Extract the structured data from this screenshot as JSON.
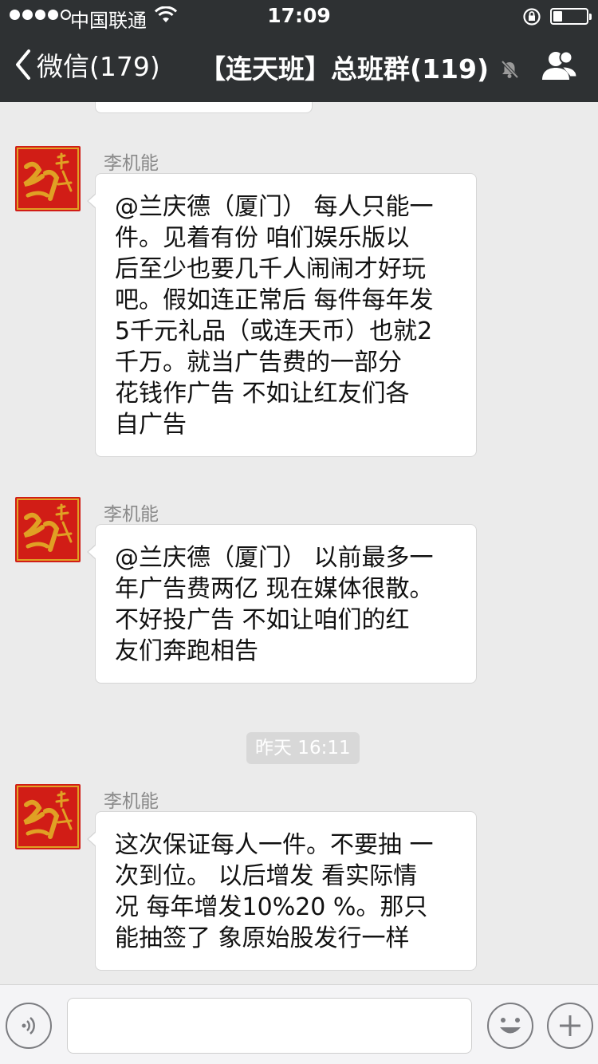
{
  "status_bar": {
    "carrier": "中国联通",
    "time": "17:09",
    "signal_bars": 4,
    "battery_level": 0.28
  },
  "nav": {
    "back_label": "微信(179)",
    "title": "【连天班】总班群(119)"
  },
  "messages": [
    {
      "sender": "李机能",
      "lines": [
        "@兰庆德（厦门） 每人只能一",
        "件。见着有份  咱们娱乐版以",
        "后至少也要几千人闹闹才好玩",
        "吧。假如连正常后 每件每年发",
        "5千元礼品（或连天币）也就2",
        "千万。就当广告费的一部分",
        "花钱作广告  不如让红友们各",
        "自广告"
      ]
    },
    {
      "sender": "李机能",
      "lines": [
        "@兰庆德（厦门） 以前最多一",
        "年广告费两亿 现在媒体很散。",
        "不好投广告  不如让咱们的红",
        "友们奔跑相告"
      ]
    },
    {
      "sender": "李机能",
      "lines": [
        "这次保证每人一件。不要抽 一",
        "次到位。 以后增发 看实际情",
        "况 每年增发10%20 %。那只",
        "能抽签了 象原始股发行一样"
      ]
    }
  ],
  "timestamp": "昨天 16:11",
  "input": {
    "value": "",
    "placeholder": ""
  },
  "colors": {
    "nav_bg": "#2e3133",
    "chat_bg": "#ebebeb",
    "avatar_red": "#d11d16",
    "avatar_gold": "#e0a024"
  }
}
